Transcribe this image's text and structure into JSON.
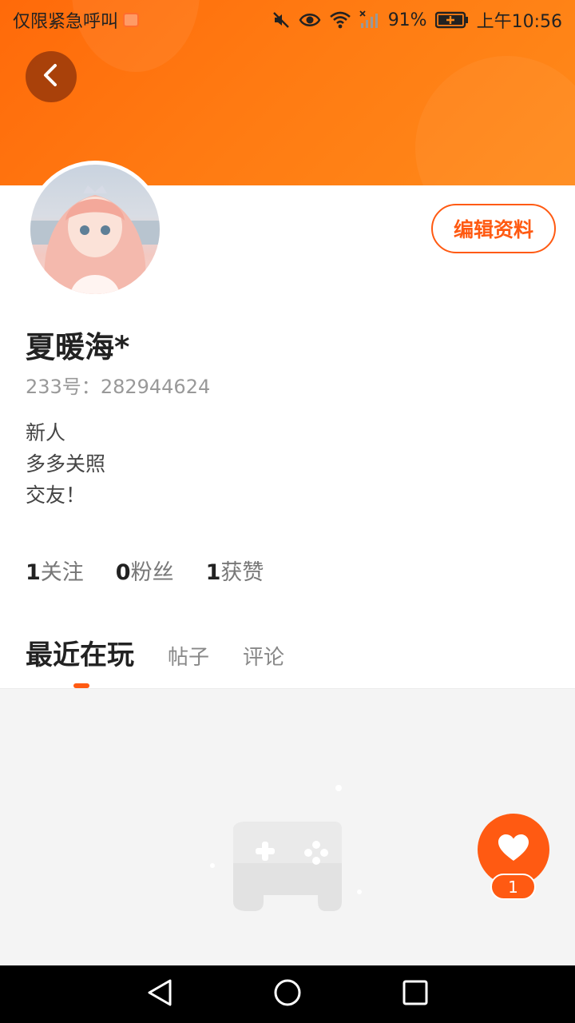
{
  "status_bar": {
    "left_text": "仅限紧急呼叫",
    "battery": "91%",
    "time": "上午10:56"
  },
  "profile": {
    "username": "夏暖海*",
    "uid_label": "233号：",
    "uid": "282944624",
    "bio": [
      "新人",
      "多多关照",
      "交友！"
    ],
    "edit_button": "编辑资料"
  },
  "stats": [
    {
      "num": "1",
      "label": "关注"
    },
    {
      "num": "0",
      "label": "粉丝"
    },
    {
      "num": "1",
      "label": "获赞"
    }
  ],
  "tabs": [
    {
      "label": "最近在玩",
      "active": true
    },
    {
      "label": "帖子",
      "active": false
    },
    {
      "label": "评论",
      "active": false
    }
  ],
  "fab": {
    "count": "1"
  },
  "colors": {
    "accent": "#ff5a12",
    "header": "#ff7a12"
  },
  "icons": [
    "back-icon",
    "mute-icon",
    "eye-icon",
    "wifi-icon",
    "signal-icon",
    "battery-icon",
    "heart-icon",
    "gamepad-icon",
    "nav-back-icon",
    "nav-home-icon",
    "nav-recents-icon"
  ]
}
